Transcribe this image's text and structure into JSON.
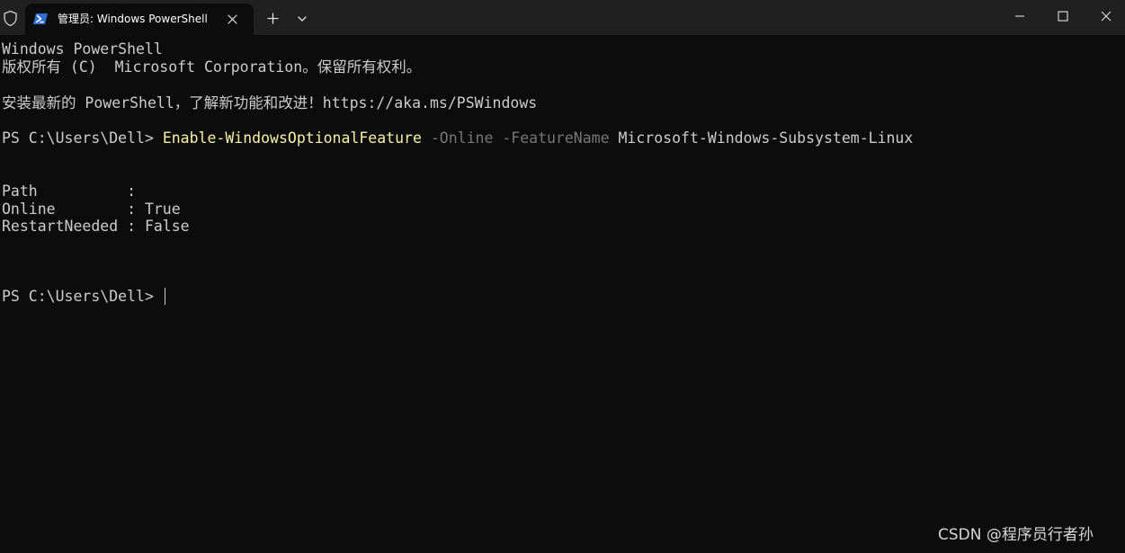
{
  "titlebar": {
    "tab": {
      "title": "管理员: Windows PowerShell",
      "icon": "powershell-icon"
    },
    "buttons": [
      "shield-icon",
      "new-tab-plus-icon",
      "chevron-down-icon",
      "minimize-icon",
      "maximize-icon",
      "close-icon"
    ]
  },
  "terminal": {
    "banner_line1": "Windows PowerShell",
    "banner_line2": "版权所有 (C)  Microsoft Corporation。保留所有权利。",
    "banner_line3": "安装最新的 PowerShell，了解新功能和改进！https://aka.ms/PSWindows",
    "command": {
      "prompt": "PS C:\\Users\\Dell> ",
      "cmdlet": "Enable-WindowsOptionalFeature",
      "param1": "-Online",
      "param2": "-FeatureName",
      "argument": "Microsoft-Windows-Subsystem-Linux"
    },
    "output": {
      "path": "Path          :",
      "online": "Online        : True",
      "restart": "RestartNeeded : False"
    },
    "current_prompt": "PS C:\\Users\\Dell> "
  },
  "watermark": "CSDN @程序员行者孙",
  "colors": {
    "background": "#0c0c0c",
    "titlebar": "#202020",
    "text": "#cccccc",
    "cmdlet": "#f9f1a5",
    "parameter": "#767676",
    "powershell_icon": "#2d6fd1"
  }
}
